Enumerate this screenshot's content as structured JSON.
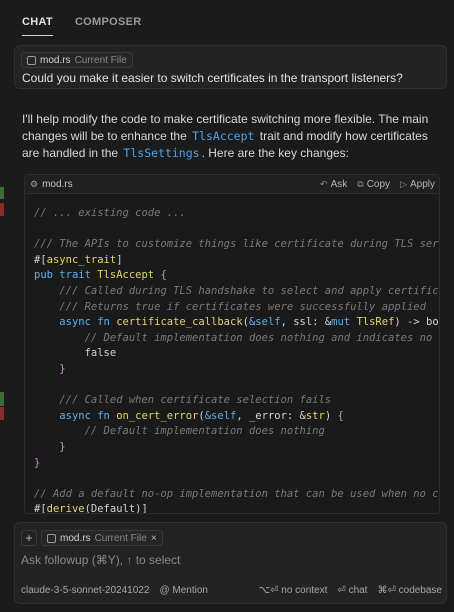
{
  "tabs": [
    {
      "label": "CHAT",
      "active": true
    },
    {
      "label": "COMPOSER",
      "active": false
    }
  ],
  "user_message": {
    "chip_name": "mod.rs",
    "chip_sub": "Current File",
    "text": "Could you make it easier to switch certificates in the transport listeners?"
  },
  "reply": {
    "part1": "I'll help modify the code to make certificate switching more flexible. The main changes will be to enhance the ",
    "code1": "TlsAccept",
    "part2": " trait and modify how certificates are handled in the ",
    "code2": "TlsSettings",
    "part3": ". Here are the key changes:"
  },
  "code_block": {
    "file": "mod.rs",
    "ask_label": "Ask",
    "copy_label": "Copy",
    "apply_label": "Apply",
    "lines": [
      "// ... existing code ...",
      "",
      "/// The APIs to customize things like certificate during TLS ser",
      "#[async_trait]",
      "pub trait TlsAccept {",
      "    /// Called during TLS handshake to select and apply certific",
      "    /// Returns true if certificates were successfully applied",
      "    async fn certificate_callback(&self, ssl: &mut TlsRef) -> bo",
      "        // Default implementation does nothing and indicates no",
      "        false",
      "    }",
      "",
      "    /// Called when certificate selection fails",
      "    async fn on_cert_error(&self, _error: &str) {",
      "        // Default implementation does nothing",
      "    }",
      "}",
      "",
      "// Add a default no-op implementation that can be used when no c",
      "#[derive(Default)]"
    ]
  },
  "composer": {
    "add_label": "+",
    "chip_name": "mod.rs",
    "chip_sub": "Current File",
    "chip_close": "×",
    "placeholder": "Ask followup (⌘Y), ↑ to select",
    "model": "claude-3-5-sonnet-20241022",
    "mention": "@ Mention",
    "no_context": "⌥⏎ no context",
    "chat": "⏎ chat",
    "codebase": "⌘⏎ codebase"
  }
}
